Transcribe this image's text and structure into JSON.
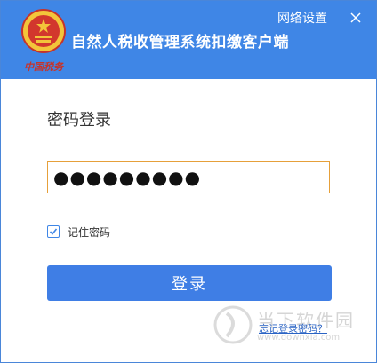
{
  "header": {
    "app_title": "自然人税收管理系统扣缴客户端",
    "network_settings": "网络设置",
    "brand_script": "中国税务"
  },
  "login": {
    "heading": "密码登录",
    "password_value": "●●●●●●●●●",
    "remember_label": "记住密码",
    "remember_checked": true,
    "login_button": "登录",
    "forgot_link": "忘记登录密码？"
  },
  "watermark": {
    "text": "当下软件园",
    "url": "www.downxia.com"
  },
  "colors": {
    "header_bg": "#3f86e6",
    "button_bg": "#3f7ee5",
    "input_border": "#e6a03a",
    "link": "#2a63c4"
  },
  "icons": {
    "emblem": "tax-emblem-icon",
    "close": "close-icon",
    "checkbox": "checkmark-icon"
  }
}
